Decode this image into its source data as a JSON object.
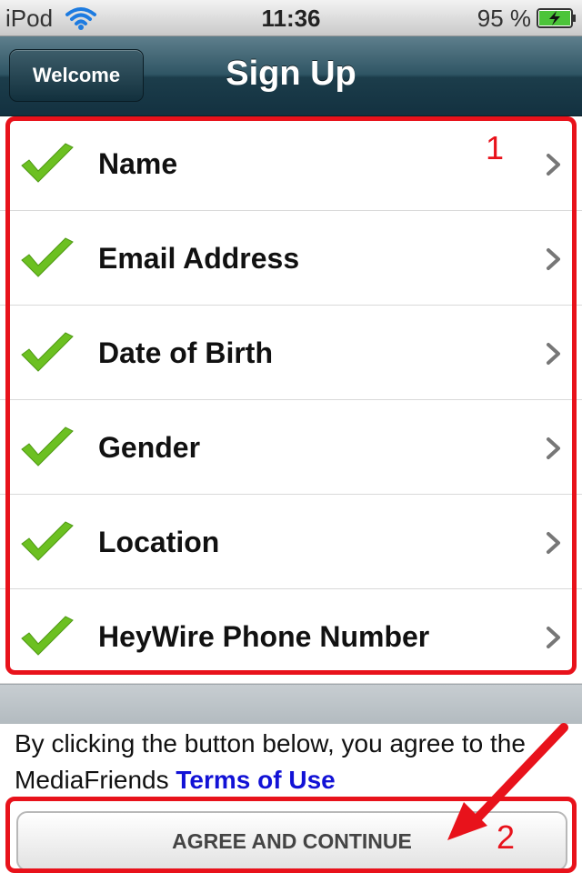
{
  "status_bar": {
    "carrier": "iPod",
    "time": "11:36",
    "battery": "95 %",
    "icons": [
      "wifi-icon",
      "battery-charging-icon"
    ]
  },
  "nav_bar": {
    "back_label": "Welcome",
    "title": "Sign Up"
  },
  "signup_items": [
    {
      "label": "Name",
      "icon": "check-icon"
    },
    {
      "label": "Email Address",
      "icon": "check-icon"
    },
    {
      "label": "Date of Birth",
      "icon": "check-icon"
    },
    {
      "label": "Gender",
      "icon": "check-icon"
    },
    {
      "label": "Location",
      "icon": "check-icon"
    },
    {
      "label": "HeyWire Phone Number",
      "icon": "check-icon"
    }
  ],
  "disclaimer": {
    "text": "By clicking the button below, you agree to the MediaFriends ",
    "link": "Terms of Use"
  },
  "agree_button": {
    "label": "AGREE AND CONTINUE"
  },
  "annotations": {
    "label_1": "1",
    "label_2": "2",
    "color": "#e8121b"
  },
  "colors": {
    "check_green": "#6cc021",
    "link_blue": "#1212d6",
    "nav_bar": "#1c3d4b"
  }
}
